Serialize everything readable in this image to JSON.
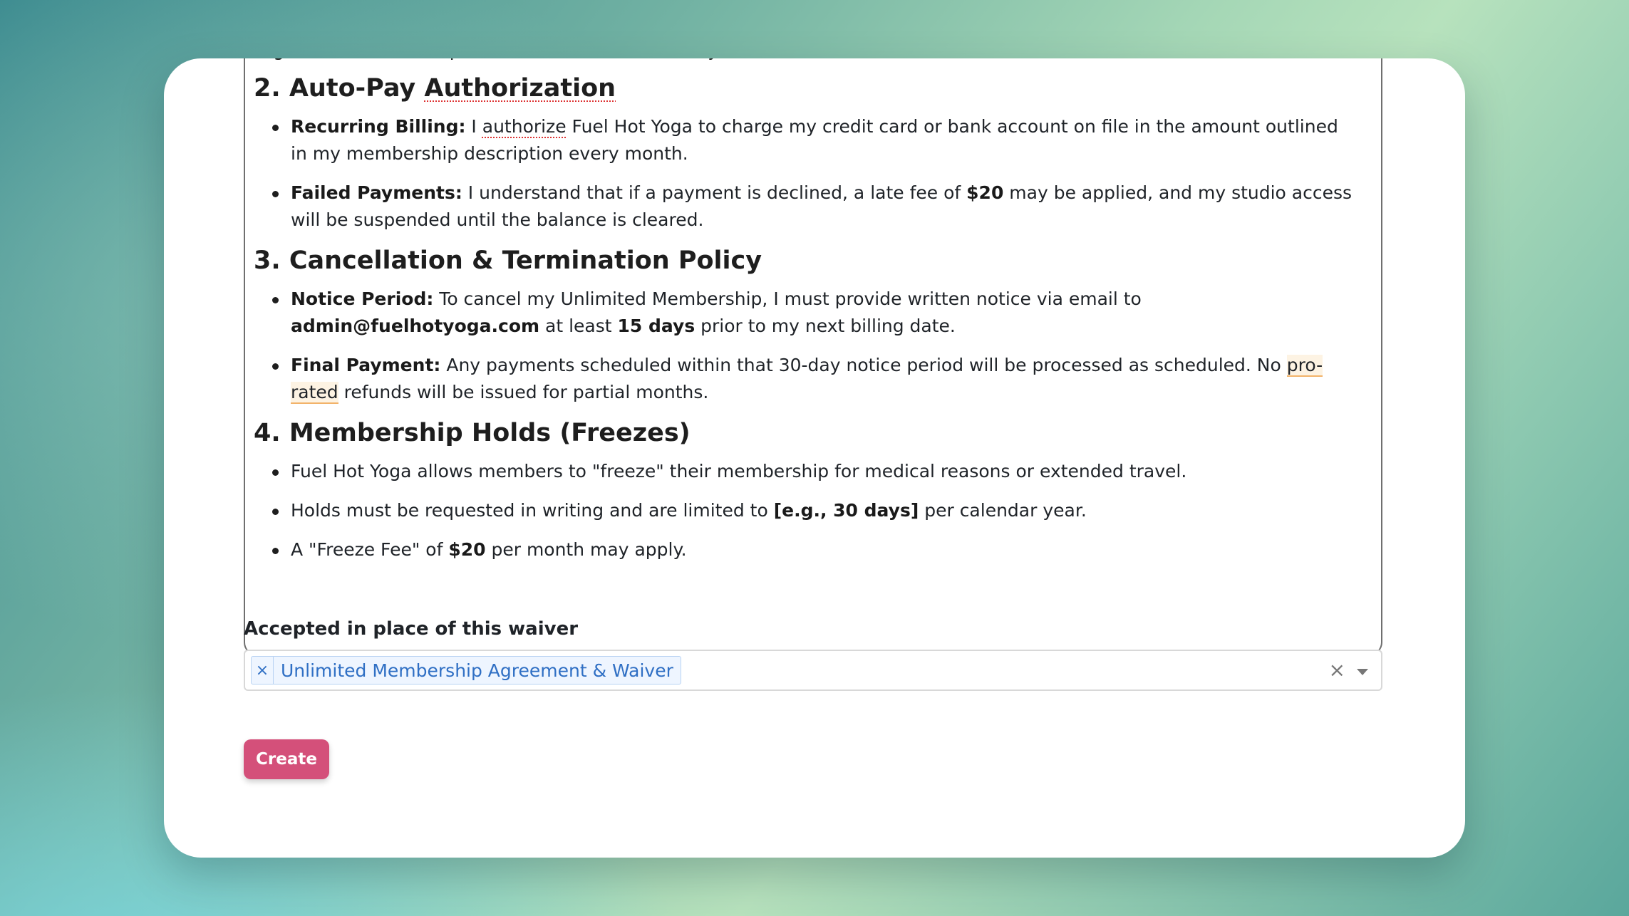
{
  "agreement": {
    "intro_tail": "Yoga. This membership is non-transferable and may not be shared with other individuals.",
    "sections": [
      {
        "title_prefix": "2. Auto-Pay ",
        "title_flagged": "Authorization",
        "items": [
          {
            "bold": "Recurring Billing:",
            "pre": " I ",
            "flagged": "authorize",
            "post": " Fuel Hot Yoga to charge my credit card or bank account on file in the amount outlined in my membership description every month."
          },
          {
            "bold": "Failed Payments:",
            "pre": " I understand that if a payment is declined, a late fee of ",
            "bold2": "$20",
            "post": " may be applied, and my studio access will be suspended until the balance is cleared."
          }
        ]
      },
      {
        "title": "3. Cancellation & Termination Policy",
        "items": [
          {
            "bold": "Notice Period:",
            "pre": " To cancel my Unlimited Membership, I must provide written notice via email to ",
            "bold2": "admin@fuelhotyoga.com",
            "mid": " at least ",
            "bold3": "15 days",
            "post": " prior to my next billing date."
          },
          {
            "bold": "Final Payment:",
            "pre": " Any payments scheduled within that 30-day notice period will be processed as scheduled. No ",
            "highlight": "pro-rated",
            "post": " refunds will be issued for partial months."
          }
        ]
      },
      {
        "title": "4. Membership Holds (Freezes)",
        "items": [
          {
            "text": "Fuel Hot Yoga allows members to \"freeze\" their membership for medical reasons or extended travel."
          },
          {
            "pre": "Holds must be requested in writing and are limited to ",
            "bold": "[e.g., 30 days]",
            "post": " per calendar year."
          },
          {
            "pre": "A \"Freeze Fee\" of ",
            "bold": "$20",
            "post": " per month may apply."
          }
        ]
      }
    ]
  },
  "accepted_field": {
    "label": "Accepted in place of this waiver",
    "selected": [
      "Unlimited Membership Agreement & Waiver"
    ],
    "chip_remove_glyph": "×",
    "clear_glyph": "×"
  },
  "actions": {
    "create_label": "Create"
  },
  "colors": {
    "accent": "#d4507a",
    "chip": "#2f6fc4"
  }
}
